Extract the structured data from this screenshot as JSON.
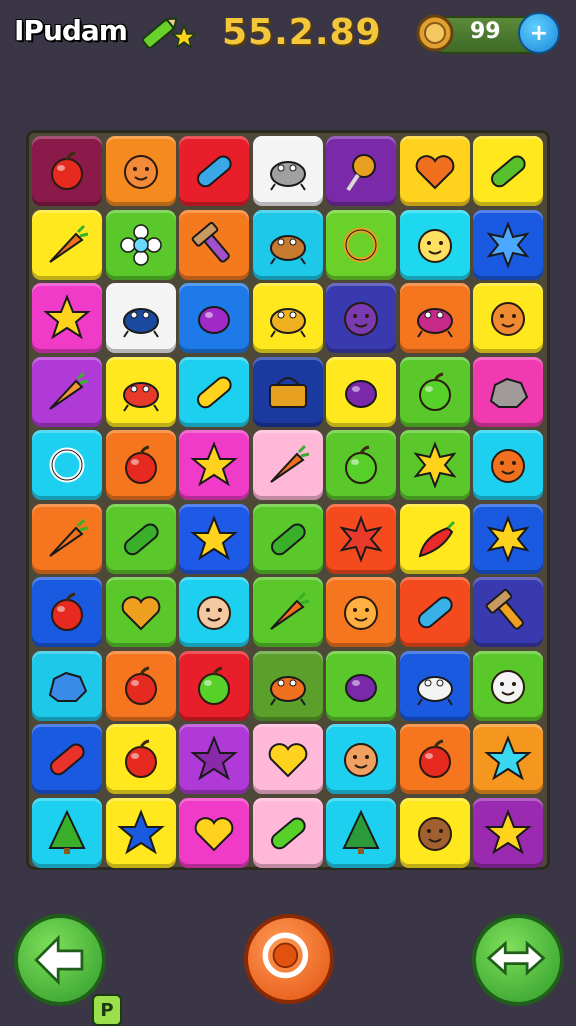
{
  "header": {
    "logo_text": "IPudam",
    "score": "55.2.89",
    "coins": "99",
    "plus_label": "+"
  },
  "colors": {
    "background": "#3a3646",
    "board": "#4d4838"
  },
  "board": {
    "columns": 7,
    "rows": 10,
    "tiles": [
      {
        "bg": "#8a1a4a",
        "icon": "apple",
        "fg": "#e62a20"
      },
      {
        "bg": "#f58a1e",
        "icon": "face",
        "fg": "#f28a3a"
      },
      {
        "bg": "#e81e2a",
        "icon": "capsule",
        "fg": "#3aa8e8"
      },
      {
        "bg": "#f4f4f4",
        "icon": "creature",
        "fg": "#a0a0a0"
      },
      {
        "bg": "#7a2aa8",
        "icon": "lollipop",
        "fg": "#e8a020"
      },
      {
        "bg": "#ffd21e",
        "icon": "heart",
        "fg": "#f07020"
      },
      {
        "bg": "#ffe81e",
        "icon": "capsule",
        "fg": "#58c02a"
      },
      {
        "bg": "#ffe81e",
        "icon": "carrot",
        "fg": "#f07020"
      },
      {
        "bg": "#5ac82a",
        "icon": "flower",
        "fg": "#ffffff"
      },
      {
        "bg": "#f57a1e",
        "icon": "hammer",
        "fg": "#a050c8"
      },
      {
        "bg": "#1ec8e8",
        "icon": "creature",
        "fg": "#c87a30"
      },
      {
        "bg": "#6ad02a",
        "icon": "ring",
        "fg": "#e8a020"
      },
      {
        "bg": "#1ed8f0",
        "icon": "face",
        "fg": "#ffe060"
      },
      {
        "bg": "#1a5ae0",
        "icon": "star-burst",
        "fg": "#4aa8ff"
      },
      {
        "bg": "#f03ac8",
        "icon": "star",
        "fg": "#ffd21e"
      },
      {
        "bg": "#f4f4f4",
        "icon": "creature",
        "fg": "#1a4aa0"
      },
      {
        "bg": "#1e7ae8",
        "icon": "plum",
        "fg": "#a02ac8"
      },
      {
        "bg": "#ffe81e",
        "icon": "creature",
        "fg": "#f0b020"
      },
      {
        "bg": "#3a3ab0",
        "icon": "face",
        "fg": "#7a3ab0"
      },
      {
        "bg": "#f5761e",
        "icon": "creature",
        "fg": "#c82a8a"
      },
      {
        "bg": "#ffe81e",
        "icon": "face",
        "fg": "#f08a30"
      },
      {
        "bg": "#b03ad8",
        "icon": "carrot",
        "fg": "#f09a30"
      },
      {
        "bg": "#ffe81e",
        "icon": "creature",
        "fg": "#e83a2a"
      },
      {
        "bg": "#1ed0f0",
        "icon": "capsule",
        "fg": "#ffd21e"
      },
      {
        "bg": "#1a3aa0",
        "icon": "basket",
        "fg": "#e8a020"
      },
      {
        "bg": "#ffe81e",
        "icon": "plum",
        "fg": "#7a2aa8"
      },
      {
        "bg": "#5ac82a",
        "icon": "apple",
        "fg": "#58d02a"
      },
      {
        "bg": "#f03ab0",
        "icon": "rock",
        "fg": "#a09a9a"
      },
      {
        "bg": "#1ed0f0",
        "icon": "ring",
        "fg": "#ffffff"
      },
      {
        "bg": "#f5761e",
        "icon": "apple",
        "fg": "#e62a20"
      },
      {
        "bg": "#f03ac8",
        "icon": "star",
        "fg": "#ffd21e"
      },
      {
        "bg": "#ffb8d8",
        "icon": "carrot",
        "fg": "#f07020"
      },
      {
        "bg": "#5ac82a",
        "icon": "apple",
        "fg": "#58d02a"
      },
      {
        "bg": "#5ac82a",
        "icon": "star-burst",
        "fg": "#ffd21e"
      },
      {
        "bg": "#1ed0f0",
        "icon": "face",
        "fg": "#f07020"
      },
      {
        "bg": "#f5761e",
        "icon": "carrot",
        "fg": "#f07020"
      },
      {
        "bg": "#5ac82a",
        "icon": "capsule",
        "fg": "#3ab02a"
      },
      {
        "bg": "#1e5ae8",
        "icon": "star",
        "fg": "#ffd21e"
      },
      {
        "bg": "#5ac82a",
        "icon": "capsule",
        "fg": "#3ab02a"
      },
      {
        "bg": "#f54a1e",
        "icon": "star-burst",
        "fg": "#e83a2a"
      },
      {
        "bg": "#ffe81e",
        "icon": "chili",
        "fg": "#e82a2a"
      },
      {
        "bg": "#1a5ae0",
        "icon": "star-burst",
        "fg": "#ffd21e"
      },
      {
        "bg": "#1a5ae0",
        "icon": "apple",
        "fg": "#e62a20"
      },
      {
        "bg": "#5ac82a",
        "icon": "heart",
        "fg": "#f0a020"
      },
      {
        "bg": "#1ed0f0",
        "icon": "face",
        "fg": "#f4c8a0"
      },
      {
        "bg": "#5ac82a",
        "icon": "carrot",
        "fg": "#f07020"
      },
      {
        "bg": "#f5761e",
        "icon": "face",
        "fg": "#ffb040"
      },
      {
        "bg": "#f54a1e",
        "icon": "capsule",
        "fg": "#3ab0e8"
      },
      {
        "bg": "#3a3ab0",
        "icon": "hammer",
        "fg": "#f0a020"
      },
      {
        "bg": "#1ec8e8",
        "icon": "rock",
        "fg": "#3a8ae8"
      },
      {
        "bg": "#f5761e",
        "icon": "apple",
        "fg": "#e62a20"
      },
      {
        "bg": "#e81e2a",
        "icon": "apple",
        "fg": "#58d02a"
      },
      {
        "bg": "#5aa02a",
        "icon": "creature",
        "fg": "#f07020"
      },
      {
        "bg": "#5ac82a",
        "icon": "plum",
        "fg": "#7a2aa8"
      },
      {
        "bg": "#1a5ae0",
        "icon": "creature",
        "fg": "#f4f4f4"
      },
      {
        "bg": "#5ac82a",
        "icon": "face",
        "fg": "#f4f4f4"
      },
      {
        "bg": "#1a5ae0",
        "icon": "capsule",
        "fg": "#e8322a"
      },
      {
        "bg": "#ffe81e",
        "icon": "apple",
        "fg": "#e62a20"
      },
      {
        "bg": "#b03ad8",
        "icon": "star",
        "fg": "#8a2aa8"
      },
      {
        "bg": "#ffb8d8",
        "icon": "heart",
        "fg": "#ffd21e"
      },
      {
        "bg": "#1ed0f0",
        "icon": "face",
        "fg": "#f0a060"
      },
      {
        "bg": "#f5761e",
        "icon": "apple",
        "fg": "#e62a20"
      },
      {
        "bg": "#f5961e",
        "icon": "star",
        "fg": "#3ad8f0"
      },
      {
        "bg": "#1ed0f0",
        "icon": "tree",
        "fg": "#3ab02a"
      },
      {
        "bg": "#ffe81e",
        "icon": "star",
        "fg": "#1a5ae0"
      },
      {
        "bg": "#f03ac8",
        "icon": "heart",
        "fg": "#ffd21e"
      },
      {
        "bg": "#ffb8d8",
        "icon": "capsule",
        "fg": "#58d02a"
      },
      {
        "bg": "#1ed0f0",
        "icon": "tree",
        "fg": "#2a9a3a"
      },
      {
        "bg": "#ffe81e",
        "icon": "face",
        "fg": "#a06030"
      },
      {
        "bg": "#9a2ab0",
        "icon": "star",
        "fg": "#ffd21e"
      }
    ]
  },
  "footer": {
    "back_badge": "P"
  }
}
